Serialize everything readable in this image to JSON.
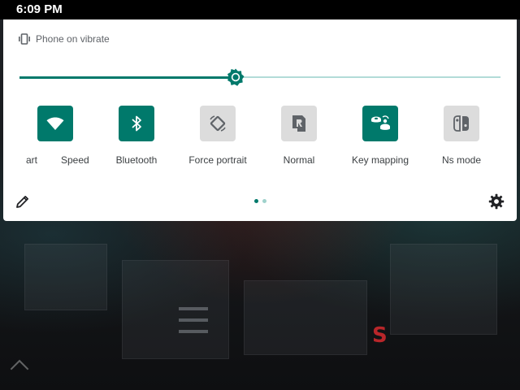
{
  "status_bar": {
    "time": "6:09 PM"
  },
  "quick_settings": {
    "ringer_status": "Phone on vibrate",
    "brightness": {
      "level": 0.45
    },
    "peek_tiles": [
      {
        "label": "art"
      },
      {
        "label": "Speed"
      }
    ],
    "tiles": [
      {
        "label": "Bluetooth",
        "icon": "bluetooth-icon",
        "active": true
      },
      {
        "label": "Force portrait",
        "icon": "screen-rotation-icon",
        "active": false
      },
      {
        "label": "Normal",
        "icon": "mode-normal-icon",
        "active": false
      },
      {
        "label": "Key mapping",
        "icon": "key-mapping-icon",
        "active": true
      },
      {
        "label": "Ns mode",
        "icon": "switch-controller-icon",
        "active": false
      }
    ],
    "wifi_tile": {
      "icon": "wifi-icon",
      "active": true
    },
    "pagination": {
      "current": 1,
      "total": 2
    },
    "colors": {
      "accent": "#00796b",
      "accent_light": "#b2dcd8",
      "tile_off": "#dcdcdc"
    }
  }
}
